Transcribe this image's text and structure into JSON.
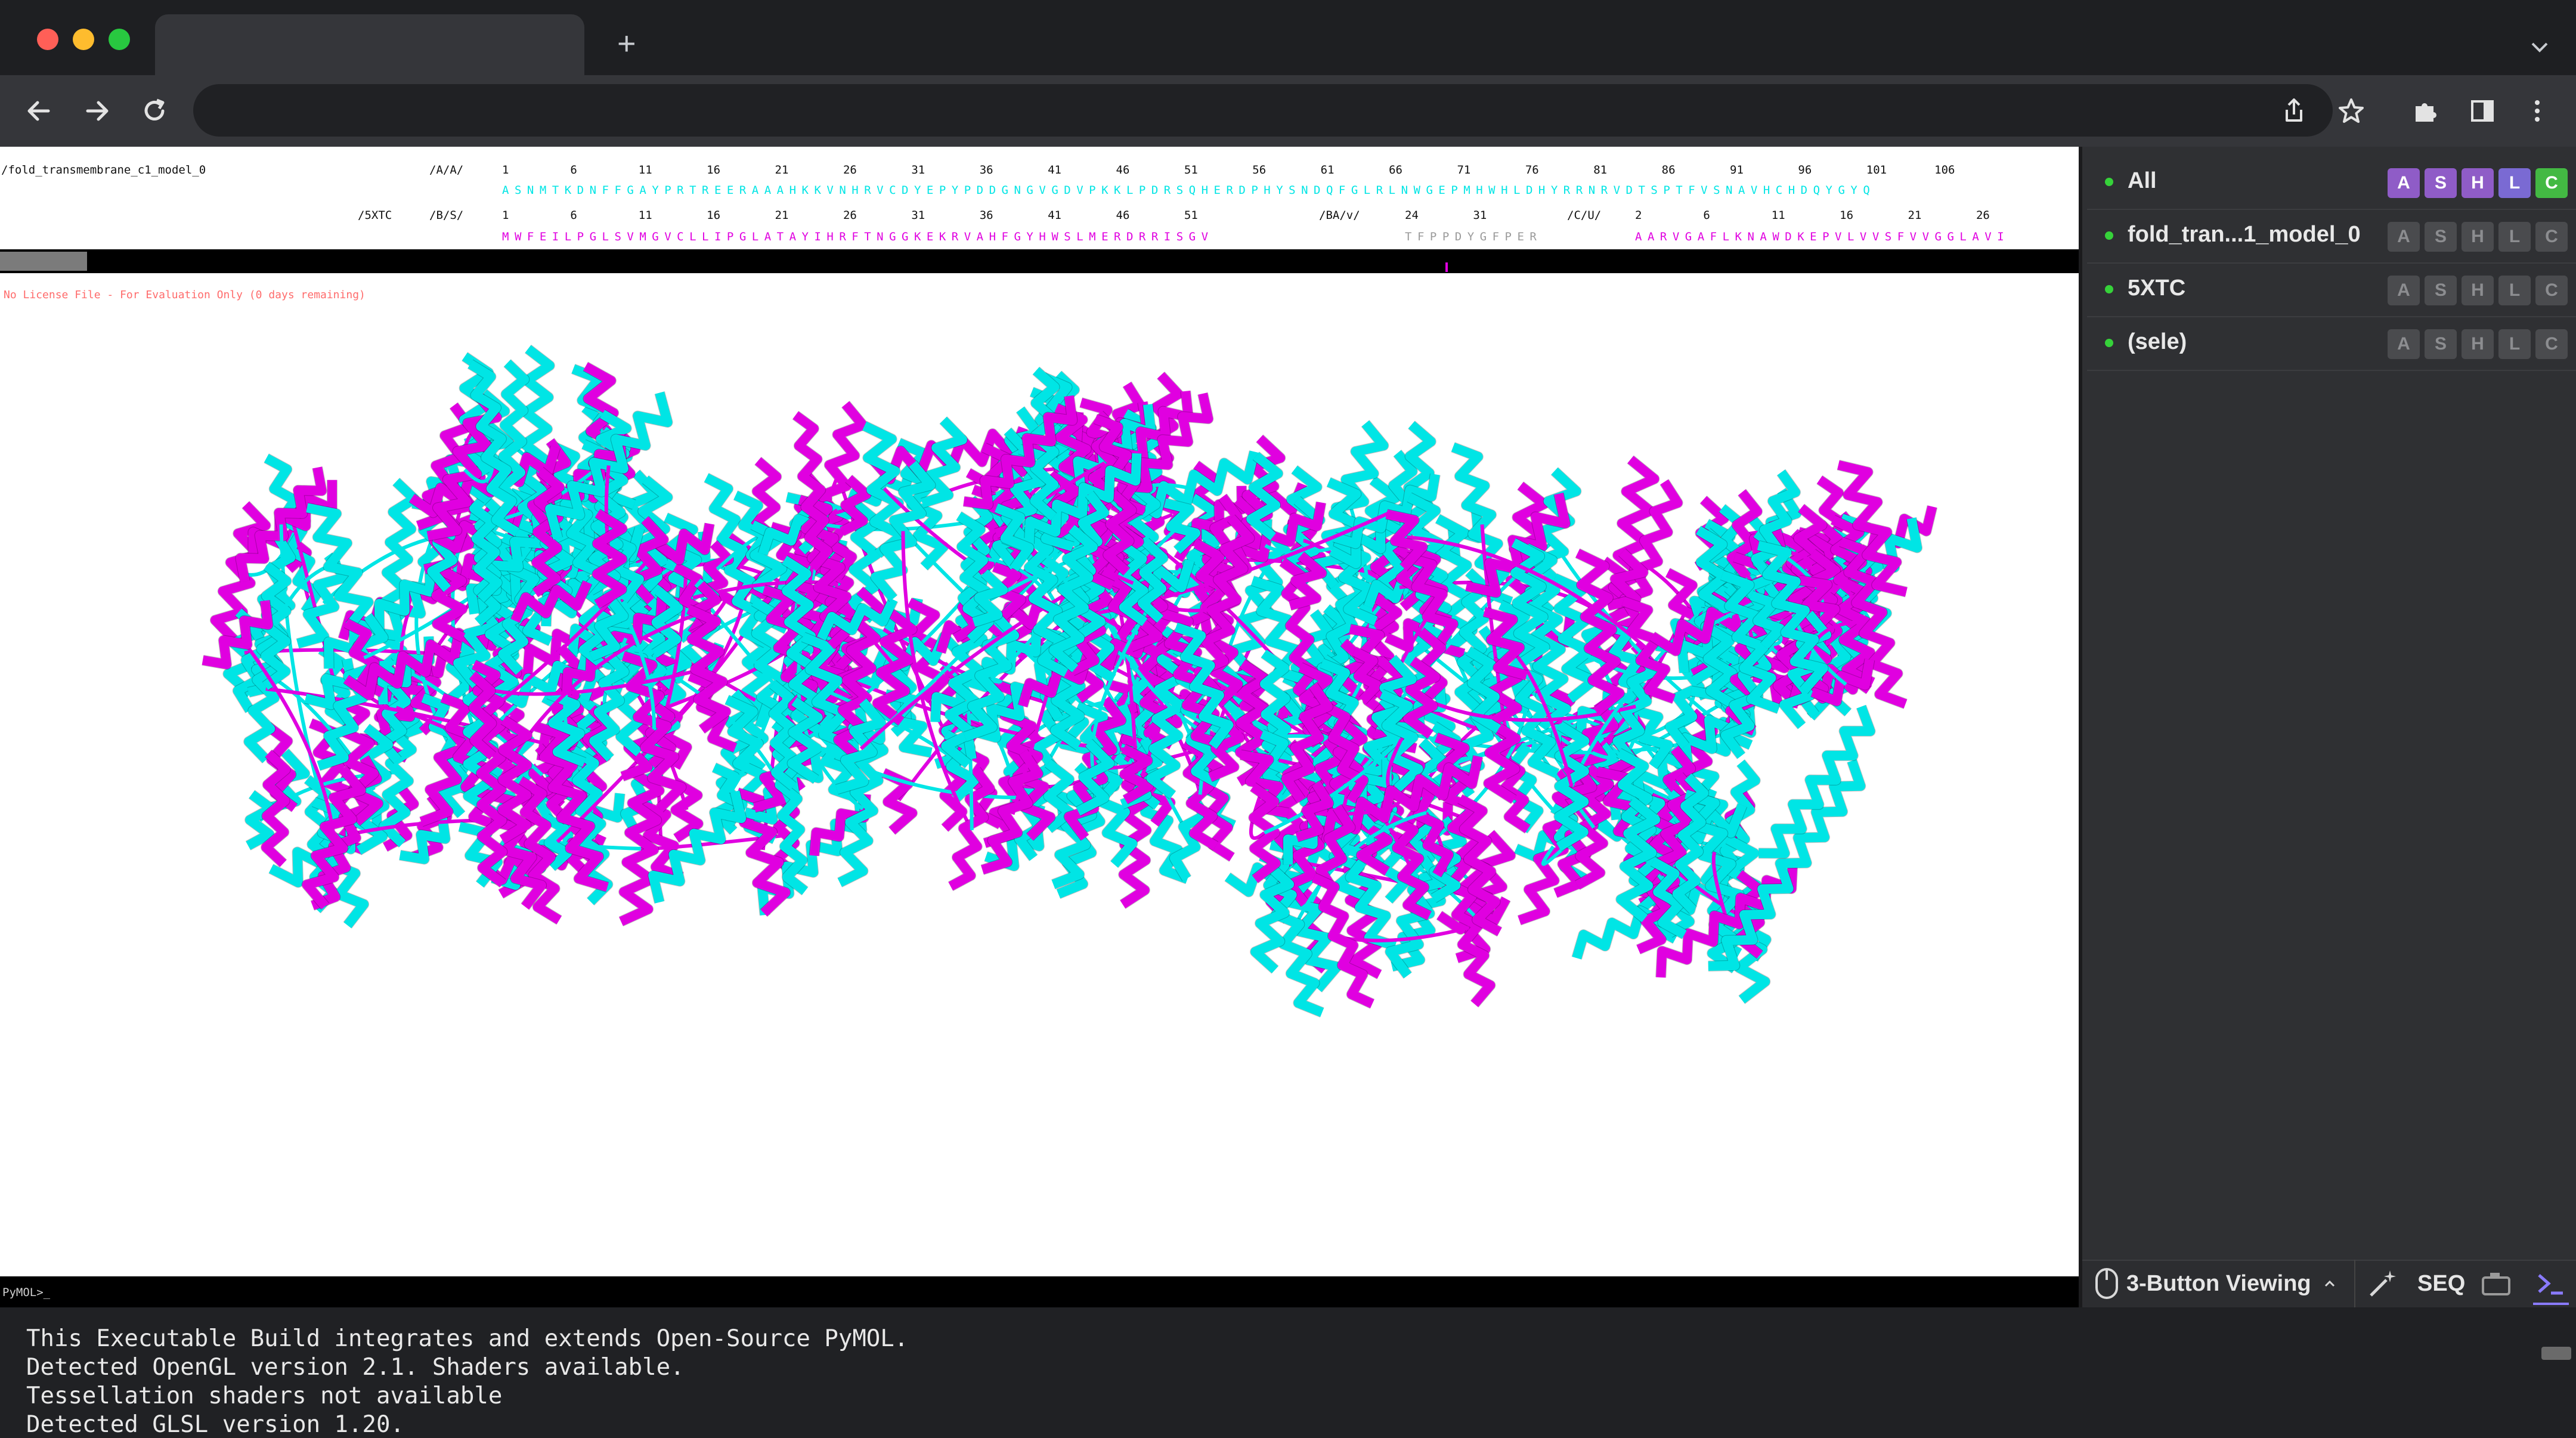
{
  "browser": {
    "tab_title": "",
    "new_tab_label": "+",
    "address": "",
    "traffic_light_colors": [
      "#ff5f57",
      "#febc2e",
      "#28c840"
    ]
  },
  "sequence_viewer": {
    "row1": {
      "object_label": "/fold_transmembrane_c1_model_0",
      "chain_label": "/A/A/",
      "numbers": "1         6         11        16        21        26        31        36        41        46        51        56        61        66        71        76        81        86        91        96        101       106",
      "sequence": "ASNMTKDNFFGAYPRTREERAAAHKKVNHRVCDYEPYPDDGNGVGDVPKKLPDRSQHERDPHYSNDQFGLRLNWGEPMHWHLDHYRRNRVDTSPTFVSNAVHCHDQYGYQ"
    },
    "row2": {
      "object_label": "/5XTC",
      "chain_label": "/B/S/",
      "numbers": "1         6         11        16        21        26        31        36        41        46        51",
      "sequence": "MWFEILPGLSVMGVCLLIPGLATAYIHRFTNGGKEKRVAHFGYHWSLMERDRRISGV",
      "segment2_label": "/BA/v/",
      "segment2_numbers": "24        31",
      "segment2_sequence": "TFPPDYGFPER",
      "segment3_label": "/C/U/",
      "segment3_numbers": "2         6         11        16        21        26",
      "segment3_sequence": "AARVGAFLKNAWDKEPVLVVSFVVGGLAVI"
    },
    "color_model": "#00e5e5",
    "color_5xtc": "#e000e0",
    "color_grey": "#9a9a9a"
  },
  "viewer": {
    "license_text": "No License File - For Evaluation Only (0 days remaining)",
    "prompt": "PyMOL>_"
  },
  "objects": [
    {
      "name": "All",
      "buttons": [
        "A",
        "S",
        "H",
        "L",
        "C"
      ],
      "highlighted": true
    },
    {
      "name": "fold_tran...1_model_0",
      "buttons": [
        "A",
        "S",
        "H",
        "L",
        "C"
      ],
      "highlighted": false
    },
    {
      "name": "5XTC",
      "buttons": [
        "A",
        "S",
        "H",
        "L",
        "C"
      ],
      "highlighted": false
    },
    {
      "name": "(sele)",
      "buttons": [
        "A",
        "S",
        "H",
        "L",
        "C"
      ],
      "highlighted": false
    }
  ],
  "bottom_controls": {
    "mouse_mode": "3-Button Viewing",
    "seq_label": "SEQ",
    "icons": [
      "mouse-icon",
      "chevron-up-icon",
      "wand-icon",
      "camera-icon",
      "terminal-icon"
    ]
  },
  "console": {
    "lines": [
      "This Executable Build integrates and extends Open-Source PyMOL.",
      "Detected OpenGL version 2.1. Shaders available.",
      "Tessellation shaders not available",
      "Detected GLSL version 1.20."
    ]
  }
}
